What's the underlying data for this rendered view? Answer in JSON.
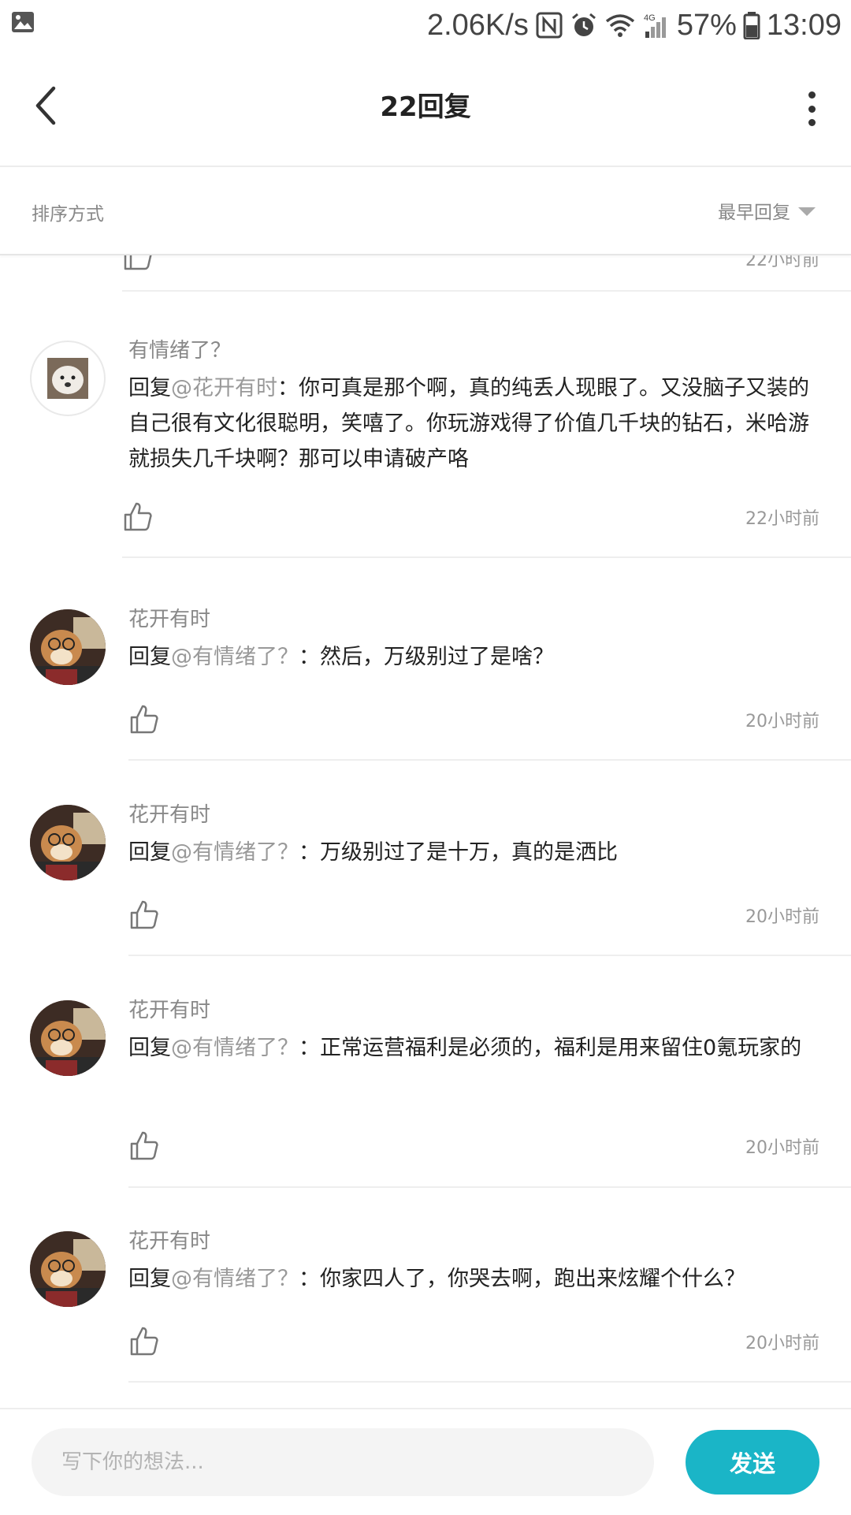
{
  "status_bar": {
    "speed": "2.06K/s",
    "network": "4G",
    "battery": "57%",
    "time": "13:09",
    "icons": [
      "image-icon",
      "nfc-icon",
      "alarm-icon",
      "wifi-icon",
      "signal-icon",
      "battery-icon"
    ]
  },
  "app_bar": {
    "title": "22回复",
    "icons": [
      "back-arrow-icon",
      "more-vert-icon"
    ]
  },
  "sort_bar": {
    "label": "排序方式",
    "value": "最早回复"
  },
  "partial_top": {
    "time": "22小时前"
  },
  "comments": [
    {
      "username": "有情绪了？",
      "reply_prefix": "回复",
      "mention": "@花开有时",
      "text": "：你可真是那个啊，真的纯丢人现眼了。又没脑子又装的自己很有文化很聪明，笑嘻了。你玩游戏得了价值几千块的钻石，米哈游就损失几千块啊？那可以申请破产咯",
      "time": "22小时前"
    },
    {
      "username": "花开有时",
      "reply_prefix": "回复",
      "mention": "@有情绪了？",
      "text": "：然后，万级别过了是啥？",
      "time": "20小时前"
    },
    {
      "username": "花开有时",
      "reply_prefix": "回复",
      "mention": "@有情绪了？",
      "text": "：万级别过了是十万，真的是洒比",
      "time": "20小时前"
    },
    {
      "username": "花开有时",
      "reply_prefix": "回复",
      "mention": "@有情绪了？",
      "text": "：正常运营福利是必须的，福利是用来留住0氪玩家的",
      "time": "20小时前"
    },
    {
      "username": "花开有时",
      "reply_prefix": "回复",
      "mention": "@有情绪了？",
      "text": "：你家四人了，你哭去啊，跑出来炫耀个什么？",
      "time": "20小时前"
    }
  ],
  "input_bar": {
    "placeholder": "写下你的想法...",
    "send_label": "发送"
  },
  "colors": {
    "accent": "#1ab5c7",
    "mention": "#999999",
    "muted": "#888888"
  }
}
